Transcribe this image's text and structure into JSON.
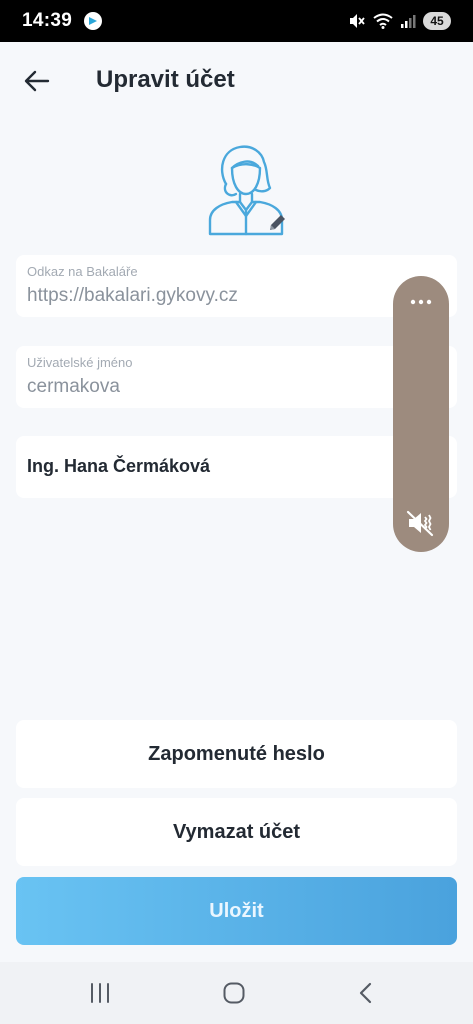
{
  "status_bar": {
    "time": "14:39",
    "battery": "45",
    "icons": [
      "app-icon",
      "mute-icon",
      "wifi-icon",
      "signal-icon",
      "battery-icon"
    ]
  },
  "header": {
    "title": "Upravit účet",
    "back_icon": "arrow-left-icon"
  },
  "avatar": {
    "icon": "user-female-avatar-icon",
    "edit_icon": "pencil-icon"
  },
  "fields": {
    "url": {
      "label": "Odkaz na Bakaláře",
      "value": "https://bakalari.gykovy.cz"
    },
    "username": {
      "label": "Uživatelské jméno",
      "value": "cermakova"
    },
    "name": {
      "value": "Ing. Hana Čermáková"
    }
  },
  "volume_overlay": {
    "more_icon": "more-horizontal-icon",
    "mute_icon": "volume-mute-icon"
  },
  "buttons": {
    "forgot_password": "Zapomenuté heslo",
    "delete_account": "Vymazat účet",
    "save": "Uložit"
  },
  "nav_bar": {
    "icons": [
      "recents-icon",
      "home-icon",
      "back-icon"
    ]
  },
  "colors": {
    "background": "#f6f8fb",
    "accent": "#4aa2dd",
    "volume_panel": "#9d8b7e"
  }
}
